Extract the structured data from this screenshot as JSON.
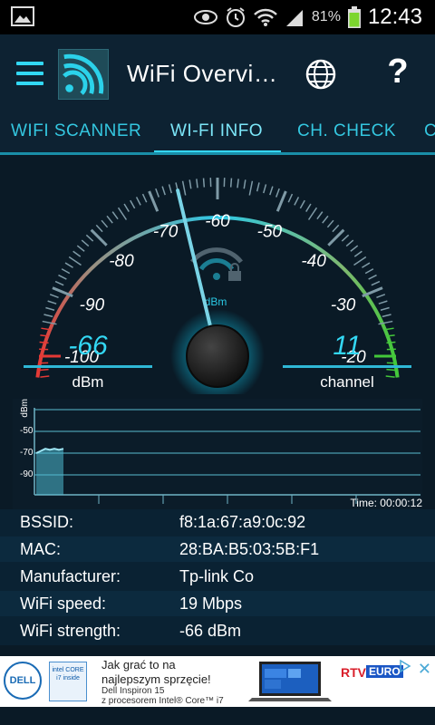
{
  "status_bar": {
    "battery_percent": "81%",
    "time": "12:43"
  },
  "toolbar": {
    "title": "WiFi Overvi…",
    "help_label": "?"
  },
  "tabs": [
    {
      "label": "WIFI SCANNER",
      "active": false
    },
    {
      "label": "WI-FI INFO",
      "active": true
    },
    {
      "label": "CH. CHECK",
      "active": false
    },
    {
      "label": "C",
      "active": false
    }
  ],
  "gauge": {
    "ticks": [
      "-100",
      "-90",
      "-80",
      "-70",
      "-60",
      "-50",
      "-40",
      "-30",
      "-20"
    ],
    "unit_label": "dBm",
    "signal_value_dbm": -66,
    "range": [
      -100,
      -20
    ]
  },
  "readouts": {
    "signal": {
      "value": "-66",
      "label": "dBm"
    },
    "channel": {
      "value": "11",
      "label": "channel"
    }
  },
  "chart": {
    "y_unit": "dBm",
    "y_ticks": [
      "-50",
      "-70",
      "-90"
    ],
    "time_label": "Time: 00:00:12",
    "values_dbm": [
      -70,
      -68,
      -66,
      -67,
      -66,
      -67,
      -66
    ]
  },
  "info": [
    {
      "key": "BSSID:",
      "value": "f8:1a:67:a9:0c:92"
    },
    {
      "key": "MAC:",
      "value": "28:BA:B5:03:5B:F1"
    },
    {
      "key": "Manufacturer:",
      "value": "Tp-link Co"
    },
    {
      "key": "WiFi speed:",
      "value": "19 Mbps"
    },
    {
      "key": "WiFi strength:",
      "value": "-66 dBm"
    }
  ],
  "ad": {
    "brand": "DELL",
    "intel_badge": "intel CORE i7 inside",
    "line1": "Jak grać to na",
    "line2": "najlepszym sprzęcie!",
    "line3": "Dell Inspiron 15",
    "line4": "z procesorem Intel® Core™ i7",
    "retailer_rtv": "RTV",
    "retailer_euro": "EURO",
    "close_label": "✕"
  },
  "colors": {
    "accent": "#33d8f4",
    "background": "#0a1a26",
    "gauge_red": "#e53935",
    "gauge_green": "#43c83a"
  }
}
